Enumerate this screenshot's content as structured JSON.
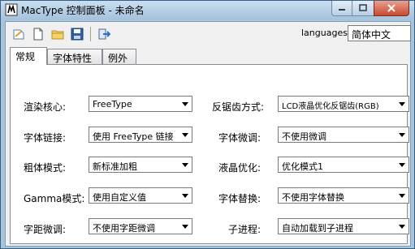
{
  "window": {
    "title": "MacType 控制面板 - 未命名"
  },
  "toolbar": {
    "icons": [
      "open-file-icon",
      "new-file-icon",
      "folder-icon",
      "save-icon",
      "exit-icon"
    ],
    "languages_label": "languages:",
    "language_value": "简体中文"
  },
  "tabs": [
    {
      "label": "常规",
      "active": true
    },
    {
      "label": "字体特性",
      "active": false
    },
    {
      "label": "例外",
      "active": false
    }
  ],
  "settings": {
    "left": [
      {
        "label": "渲染核心:",
        "value": "FreeType"
      },
      {
        "label": "字体链接:",
        "value": "使用 FreeType 链接"
      },
      {
        "label": "粗体模式:",
        "value": "新标准加粗"
      },
      {
        "label": "Gamma模式:",
        "value": "使用自定义值"
      },
      {
        "label": "字距微调:",
        "value": "不使用字距微调"
      }
    ],
    "right": [
      {
        "label": "反锯齿方式:",
        "value": "LCD液晶优化反锯齿(RGB)"
      },
      {
        "label": "字体微调:",
        "value": "不使用微调"
      },
      {
        "label": "液晶优化:",
        "value": "优化模式1"
      },
      {
        "label": "字体替换:",
        "value": "不使用字体替换"
      },
      {
        "label": "子进程:",
        "value": "自动加载到子进程"
      }
    ]
  },
  "colors": {
    "title_bar": "#b8d1e8",
    "close_button": "#c84a30",
    "panel_bg": "#ffffff",
    "window_bg": "#f0f0f0"
  }
}
